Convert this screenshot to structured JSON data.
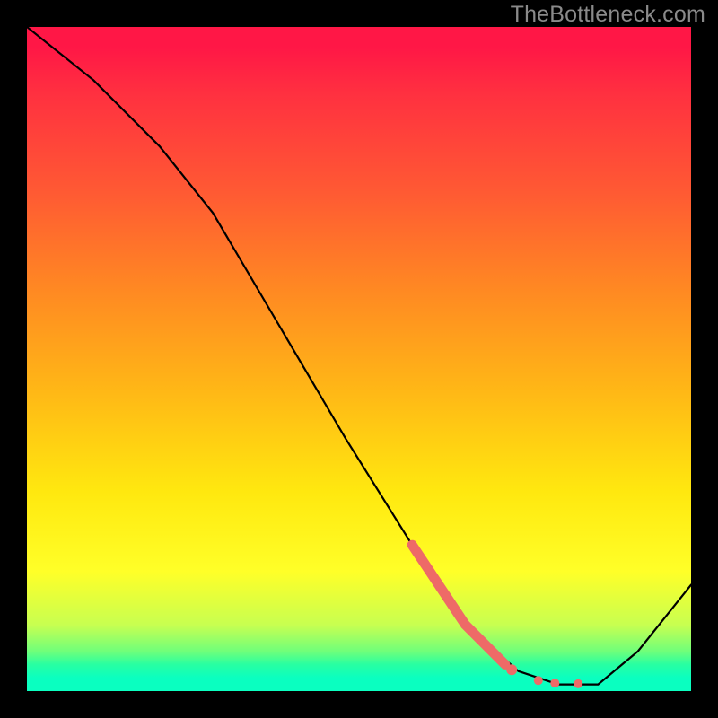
{
  "watermark": "TheBottleneck.com",
  "colors": {
    "highlight": "#ee6a67",
    "curve": "#000000"
  },
  "chart_data": {
    "type": "line",
    "title": "",
    "xlabel": "",
    "ylabel": "",
    "xlim": [
      0,
      100
    ],
    "ylim": [
      0,
      100
    ],
    "grid": false,
    "legend": false,
    "series": [
      {
        "name": "bottleneck-curve",
        "x": [
          0,
          10,
          20,
          28,
          38,
          48,
          58,
          66,
          74,
          80,
          86,
          92,
          100
        ],
        "y": [
          100,
          92,
          82,
          72,
          55,
          38,
          22,
          10,
          3,
          1,
          1,
          6,
          16
        ]
      }
    ],
    "highlight_segment": {
      "x": [
        58,
        66,
        72
      ],
      "y": [
        22,
        10,
        4
      ]
    },
    "highlight_dots": {
      "x": [
        73,
        77,
        79.5,
        83
      ],
      "y": [
        3.2,
        1.6,
        1.2,
        1.1
      ]
    },
    "annotations": []
  }
}
